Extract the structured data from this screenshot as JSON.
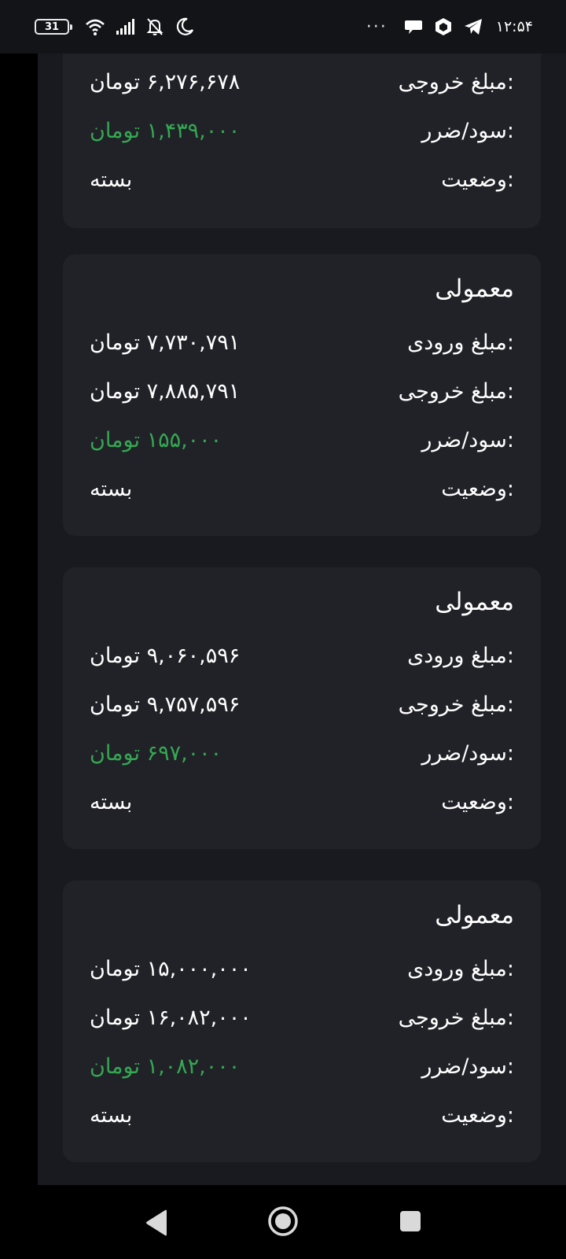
{
  "status_bar": {
    "battery": "31",
    "time": "۱۲:۵۴",
    "more": "···"
  },
  "cards": [
    {
      "title": "",
      "rows": [
        {
          "label": "مبلغ خروجی:",
          "value": "۶,۲۷۶,۶۷۸ تومان",
          "type": "normal"
        },
        {
          "label": "سود/ضرر:",
          "value": "۱,۴۳۹,۰۰۰ تومان",
          "type": "profit"
        },
        {
          "label": "وضعیت:",
          "value": "بسته",
          "type": "normal"
        }
      ]
    },
    {
      "title": "معمولی",
      "rows": [
        {
          "label": "مبلغ ورودی:",
          "value": "۷,۷۳۰,۷۹۱ تومان",
          "type": "normal"
        },
        {
          "label": "مبلغ خروجی:",
          "value": "۷,۸۸۵,۷۹۱ تومان",
          "type": "normal"
        },
        {
          "label": "سود/ضرر:",
          "value": "۱۵۵,۰۰۰ تومان",
          "type": "profit"
        },
        {
          "label": "وضعیت:",
          "value": "بسته",
          "type": "normal"
        }
      ]
    },
    {
      "title": "معمولی",
      "rows": [
        {
          "label": "مبلغ ورودی:",
          "value": "۹,۰۶۰,۵۹۶ تومان",
          "type": "normal"
        },
        {
          "label": "مبلغ خروجی:",
          "value": "۹,۷۵۷,۵۹۶ تومان",
          "type": "normal"
        },
        {
          "label": "سود/ضرر:",
          "value": "۶۹۷,۰۰۰ تومان",
          "type": "profit"
        },
        {
          "label": "وضعیت:",
          "value": "بسته",
          "type": "normal"
        }
      ]
    },
    {
      "title": "معمولی",
      "rows": [
        {
          "label": "مبلغ ورودی:",
          "value": "۱۵,۰۰۰,۰۰۰ تومان",
          "type": "normal"
        },
        {
          "label": "مبلغ خروجی:",
          "value": "۱۶,۰۸۲,۰۰۰ تومان",
          "type": "normal"
        },
        {
          "label": "سود/ضرر:",
          "value": "۱,۰۸۲,۰۰۰ تومان",
          "type": "profit"
        },
        {
          "label": "وضعیت:",
          "value": "بسته",
          "type": "normal"
        }
      ]
    }
  ],
  "colors": {
    "profit": "#34a853",
    "card_bg": "#212227",
    "page_bg": "#191a1f"
  },
  "icons": [
    "wifi-icon",
    "signal-icon",
    "bell-off-icon",
    "moon-icon",
    "chat-icon",
    "hexagon-icon",
    "telegram-icon",
    "back-icon",
    "home-icon",
    "recents-icon"
  ]
}
